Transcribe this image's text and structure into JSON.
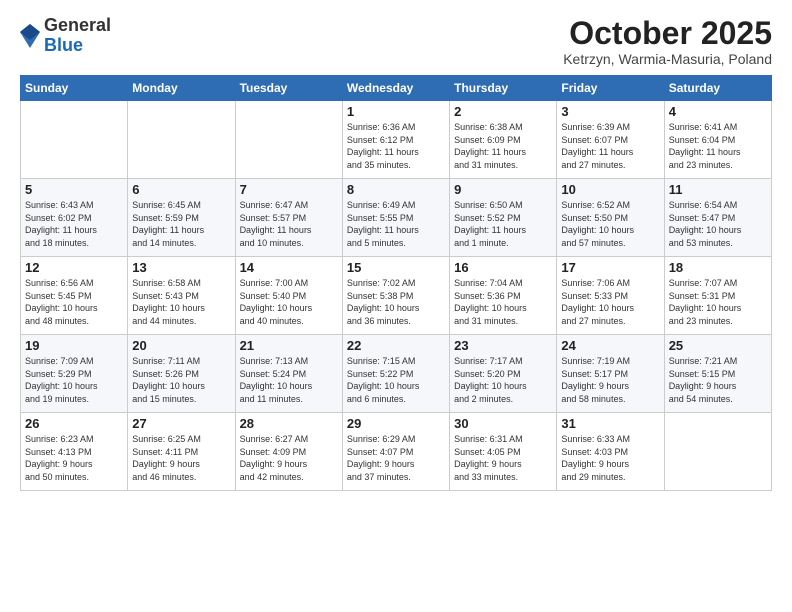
{
  "header": {
    "logo_general": "General",
    "logo_blue": "Blue",
    "month_title": "October 2025",
    "location": "Ketrzyn, Warmia-Masuria, Poland"
  },
  "weekdays": [
    "Sunday",
    "Monday",
    "Tuesday",
    "Wednesday",
    "Thursday",
    "Friday",
    "Saturday"
  ],
  "weeks": [
    [
      {
        "day": "",
        "info": ""
      },
      {
        "day": "",
        "info": ""
      },
      {
        "day": "",
        "info": ""
      },
      {
        "day": "1",
        "info": "Sunrise: 6:36 AM\nSunset: 6:12 PM\nDaylight: 11 hours\nand 35 minutes."
      },
      {
        "day": "2",
        "info": "Sunrise: 6:38 AM\nSunset: 6:09 PM\nDaylight: 11 hours\nand 31 minutes."
      },
      {
        "day": "3",
        "info": "Sunrise: 6:39 AM\nSunset: 6:07 PM\nDaylight: 11 hours\nand 27 minutes."
      },
      {
        "day": "4",
        "info": "Sunrise: 6:41 AM\nSunset: 6:04 PM\nDaylight: 11 hours\nand 23 minutes."
      }
    ],
    [
      {
        "day": "5",
        "info": "Sunrise: 6:43 AM\nSunset: 6:02 PM\nDaylight: 11 hours\nand 18 minutes."
      },
      {
        "day": "6",
        "info": "Sunrise: 6:45 AM\nSunset: 5:59 PM\nDaylight: 11 hours\nand 14 minutes."
      },
      {
        "day": "7",
        "info": "Sunrise: 6:47 AM\nSunset: 5:57 PM\nDaylight: 11 hours\nand 10 minutes."
      },
      {
        "day": "8",
        "info": "Sunrise: 6:49 AM\nSunset: 5:55 PM\nDaylight: 11 hours\nand 5 minutes."
      },
      {
        "day": "9",
        "info": "Sunrise: 6:50 AM\nSunset: 5:52 PM\nDaylight: 11 hours\nand 1 minute."
      },
      {
        "day": "10",
        "info": "Sunrise: 6:52 AM\nSunset: 5:50 PM\nDaylight: 10 hours\nand 57 minutes."
      },
      {
        "day": "11",
        "info": "Sunrise: 6:54 AM\nSunset: 5:47 PM\nDaylight: 10 hours\nand 53 minutes."
      }
    ],
    [
      {
        "day": "12",
        "info": "Sunrise: 6:56 AM\nSunset: 5:45 PM\nDaylight: 10 hours\nand 48 minutes."
      },
      {
        "day": "13",
        "info": "Sunrise: 6:58 AM\nSunset: 5:43 PM\nDaylight: 10 hours\nand 44 minutes."
      },
      {
        "day": "14",
        "info": "Sunrise: 7:00 AM\nSunset: 5:40 PM\nDaylight: 10 hours\nand 40 minutes."
      },
      {
        "day": "15",
        "info": "Sunrise: 7:02 AM\nSunset: 5:38 PM\nDaylight: 10 hours\nand 36 minutes."
      },
      {
        "day": "16",
        "info": "Sunrise: 7:04 AM\nSunset: 5:36 PM\nDaylight: 10 hours\nand 31 minutes."
      },
      {
        "day": "17",
        "info": "Sunrise: 7:06 AM\nSunset: 5:33 PM\nDaylight: 10 hours\nand 27 minutes."
      },
      {
        "day": "18",
        "info": "Sunrise: 7:07 AM\nSunset: 5:31 PM\nDaylight: 10 hours\nand 23 minutes."
      }
    ],
    [
      {
        "day": "19",
        "info": "Sunrise: 7:09 AM\nSunset: 5:29 PM\nDaylight: 10 hours\nand 19 minutes."
      },
      {
        "day": "20",
        "info": "Sunrise: 7:11 AM\nSunset: 5:26 PM\nDaylight: 10 hours\nand 15 minutes."
      },
      {
        "day": "21",
        "info": "Sunrise: 7:13 AM\nSunset: 5:24 PM\nDaylight: 10 hours\nand 11 minutes."
      },
      {
        "day": "22",
        "info": "Sunrise: 7:15 AM\nSunset: 5:22 PM\nDaylight: 10 hours\nand 6 minutes."
      },
      {
        "day": "23",
        "info": "Sunrise: 7:17 AM\nSunset: 5:20 PM\nDaylight: 10 hours\nand 2 minutes."
      },
      {
        "day": "24",
        "info": "Sunrise: 7:19 AM\nSunset: 5:17 PM\nDaylight: 9 hours\nand 58 minutes."
      },
      {
        "day": "25",
        "info": "Sunrise: 7:21 AM\nSunset: 5:15 PM\nDaylight: 9 hours\nand 54 minutes."
      }
    ],
    [
      {
        "day": "26",
        "info": "Sunrise: 6:23 AM\nSunset: 4:13 PM\nDaylight: 9 hours\nand 50 minutes."
      },
      {
        "day": "27",
        "info": "Sunrise: 6:25 AM\nSunset: 4:11 PM\nDaylight: 9 hours\nand 46 minutes."
      },
      {
        "day": "28",
        "info": "Sunrise: 6:27 AM\nSunset: 4:09 PM\nDaylight: 9 hours\nand 42 minutes."
      },
      {
        "day": "29",
        "info": "Sunrise: 6:29 AM\nSunset: 4:07 PM\nDaylight: 9 hours\nand 37 minutes."
      },
      {
        "day": "30",
        "info": "Sunrise: 6:31 AM\nSunset: 4:05 PM\nDaylight: 9 hours\nand 33 minutes."
      },
      {
        "day": "31",
        "info": "Sunrise: 6:33 AM\nSunset: 4:03 PM\nDaylight: 9 hours\nand 29 minutes."
      },
      {
        "day": "",
        "info": ""
      }
    ]
  ]
}
